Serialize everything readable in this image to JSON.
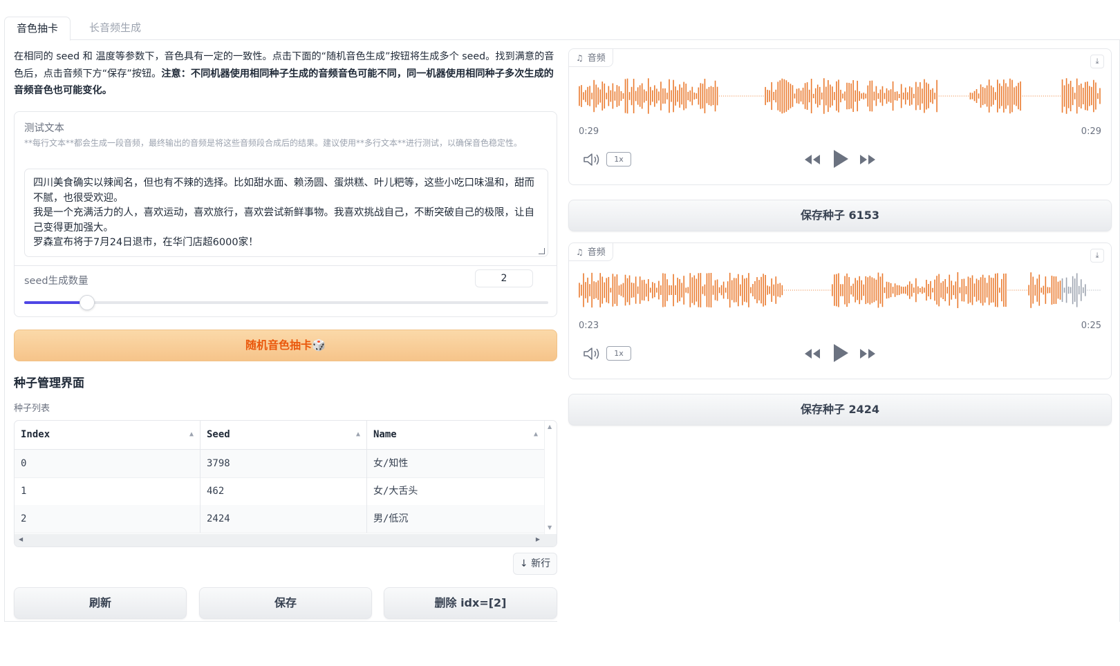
{
  "tabs": [
    {
      "label": "音色抽卡",
      "active": true
    },
    {
      "label": "长音频生成",
      "active": false
    }
  ],
  "description": {
    "normal": "在相同的 seed 和 温度等参数下，音色具有一定的一致性。点击下面的“随机音色生成”按钮将生成多个 seed。找到满意的音色后，点击音频下方“保存”按钮。",
    "bold": "注意：不同机器使用相同种子生成的音频音色可能不同，同一机器使用相同种子多次生成的音频音色也可能变化。"
  },
  "test_text": {
    "label": "测试文本",
    "info": "**每行文本**都会生成一段音频，最终输出的音频是将这些音频段合成后的结果。建议使用**多行文本**进行测试，以确保音色稳定性。",
    "value": "四川美食确实以辣闻名，但也有不辣的选择。比如甜水面、赖汤圆、蛋烘糕、叶儿粑等，这些小吃口味温和，甜而不腻，也很受欢迎。\n我是一个充满活力的人，喜欢运动，喜欢旅行，喜欢尝试新鲜事物。我喜欢挑战自己，不断突破自己的极限，让自己变得更加强大。\n罗森宣布将于7月24日退市，在华门店超6000家！"
  },
  "seed_count": {
    "label": "seed生成数量",
    "value": "2",
    "slider_fraction": 0.12
  },
  "random_button": {
    "label": "随机音色抽卡🎲"
  },
  "seed_manager": {
    "title": "种子管理界面",
    "list_label": "种子列表",
    "columns": [
      "Index",
      "Seed",
      "Name"
    ],
    "rows": [
      [
        "0",
        "3798",
        "女/知性"
      ],
      [
        "1",
        "462",
        "女/大舌头"
      ],
      [
        "2",
        "2424",
        "男/低沉"
      ]
    ],
    "new_row_label": "↓ 新行"
  },
  "actions": {
    "refresh": "刷新",
    "save": "保存",
    "delete": "删除 idx=[2]"
  },
  "audios": [
    {
      "tag": "音频",
      "current_time": "0:29",
      "duration": "0:29",
      "speed": "1x",
      "played_fraction": 1.0,
      "save_label": "保存种子 6153"
    },
    {
      "tag": "音频",
      "current_time": "0:23",
      "duration": "0:25",
      "speed": "1x",
      "played_fraction": 0.92,
      "save_label": "保存种子 2424"
    }
  ],
  "colors": {
    "accent": "#4f46e5",
    "wave_played": "#ea7a2e",
    "wave_unplayed": "#9ca3af",
    "button_orange_text": "#ea580c"
  }
}
